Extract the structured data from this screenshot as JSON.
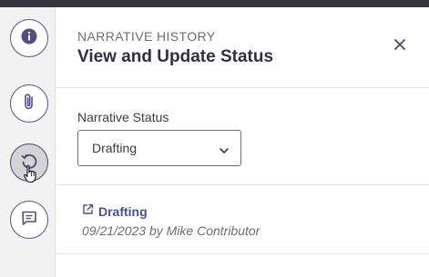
{
  "panel": {
    "eyebrow": "NARRATIVE HISTORY",
    "title": "View and Update Status",
    "status_label": "Narrative Status",
    "status_value": "Drafting"
  },
  "history": [
    {
      "status": "Drafting",
      "meta": "09/21/2023 by Mike Contributor"
    }
  ],
  "rail": {
    "items": [
      {
        "icon": "info-icon"
      },
      {
        "icon": "paperclip-icon"
      },
      {
        "icon": "history-icon",
        "active": true
      },
      {
        "icon": "comment-icon"
      }
    ]
  },
  "colors": {
    "accent": "#5b5488",
    "link": "#4b4f96",
    "topbar": "#34363f"
  }
}
